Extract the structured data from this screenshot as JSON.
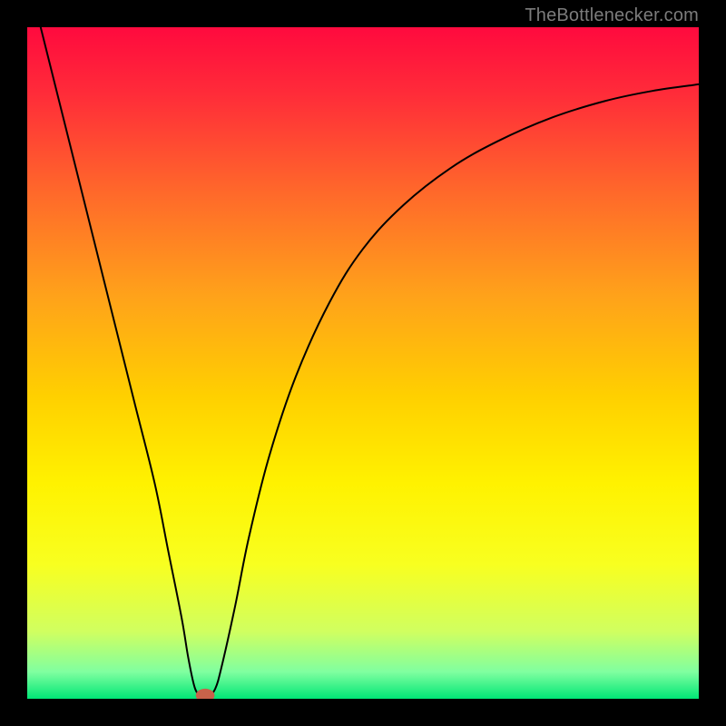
{
  "attribution": "TheBottlenecker.com",
  "chart_data": {
    "type": "line",
    "title": "",
    "xlabel": "",
    "ylabel": "",
    "xlim": [
      0,
      100
    ],
    "ylim": [
      0,
      100
    ],
    "background_gradient": {
      "stops": [
        {
          "offset": 0.0,
          "color": "#ff0a3e"
        },
        {
          "offset": 0.1,
          "color": "#ff2c39"
        },
        {
          "offset": 0.25,
          "color": "#ff6a2a"
        },
        {
          "offset": 0.4,
          "color": "#ffa21a"
        },
        {
          "offset": 0.55,
          "color": "#ffd000"
        },
        {
          "offset": 0.68,
          "color": "#fff200"
        },
        {
          "offset": 0.8,
          "color": "#f8ff20"
        },
        {
          "offset": 0.9,
          "color": "#d0ff60"
        },
        {
          "offset": 0.96,
          "color": "#80ffa0"
        },
        {
          "offset": 1.0,
          "color": "#00e676"
        }
      ]
    },
    "series": [
      {
        "name": "bottleneck-curve",
        "stroke": "#000000",
        "stroke_width": 2.0,
        "points": [
          {
            "x": 2.0,
            "y": 100.0
          },
          {
            "x": 4.0,
            "y": 92.0
          },
          {
            "x": 7.0,
            "y": 80.0
          },
          {
            "x": 10.0,
            "y": 68.0
          },
          {
            "x": 13.0,
            "y": 56.0
          },
          {
            "x": 16.0,
            "y": 44.0
          },
          {
            "x": 19.0,
            "y": 32.0
          },
          {
            "x": 21.0,
            "y": 22.0
          },
          {
            "x": 23.0,
            "y": 12.0
          },
          {
            "x": 24.0,
            "y": 6.0
          },
          {
            "x": 25.0,
            "y": 1.5
          },
          {
            "x": 26.0,
            "y": 0.5
          },
          {
            "x": 27.0,
            "y": 0.5
          },
          {
            "x": 28.0,
            "y": 1.5
          },
          {
            "x": 29.0,
            "y": 5.0
          },
          {
            "x": 31.0,
            "y": 14.0
          },
          {
            "x": 33.0,
            "y": 24.0
          },
          {
            "x": 36.0,
            "y": 36.0
          },
          {
            "x": 40.0,
            "y": 48.0
          },
          {
            "x": 45.0,
            "y": 59.0
          },
          {
            "x": 50.0,
            "y": 67.0
          },
          {
            "x": 56.0,
            "y": 73.5
          },
          {
            "x": 63.0,
            "y": 79.0
          },
          {
            "x": 70.0,
            "y": 83.0
          },
          {
            "x": 78.0,
            "y": 86.5
          },
          {
            "x": 86.0,
            "y": 89.0
          },
          {
            "x": 93.0,
            "y": 90.5
          },
          {
            "x": 100.0,
            "y": 91.5
          }
        ]
      }
    ],
    "marker": {
      "name": "optimal-point",
      "x": 26.5,
      "y": 0.5,
      "rx": 1.4,
      "ry": 1.0,
      "color": "#c8624a"
    }
  }
}
